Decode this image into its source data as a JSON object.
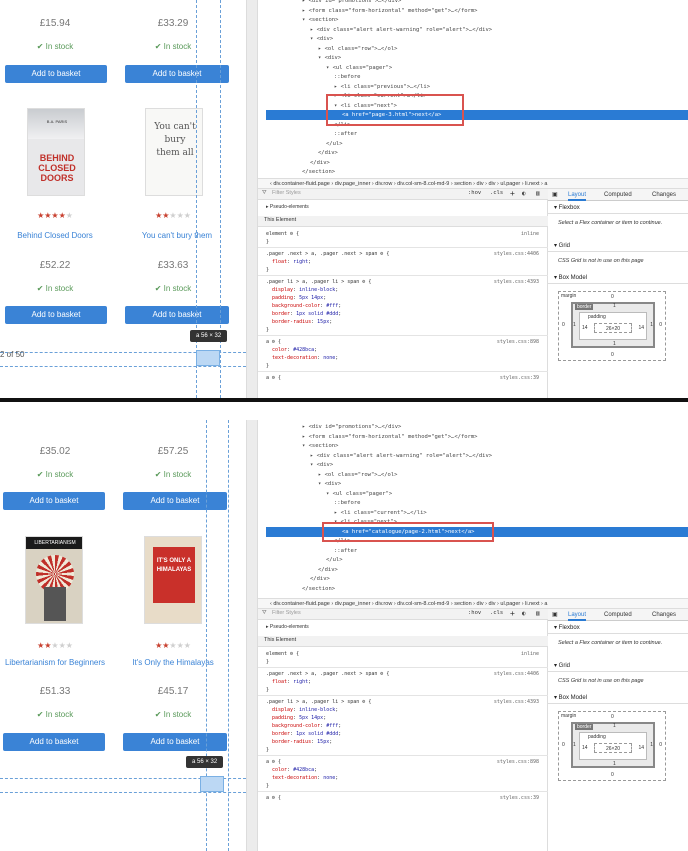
{
  "panels": [
    {
      "products_top": {
        "left": {
          "price": "£15.94",
          "stock": "In stock",
          "button": "Add to basket"
        },
        "right": {
          "price": "£33.29",
          "stock": "In stock",
          "button": "Add to basket"
        }
      },
      "products": [
        {
          "cover_text": "BEHIND CLOSED DOORS",
          "cover_author": "B.A. PARIS",
          "title": "Behind Closed Doors",
          "rating": 4,
          "price": "£52.22",
          "stock": "In stock",
          "button": "Add to basket"
        },
        {
          "cover_text": "You can't bury them all",
          "title": "You can't bury them",
          "rating": 2,
          "price": "£33.63",
          "stock": "In stock",
          "button": "Add to basket"
        }
      ],
      "page_info": "2 of 50",
      "tooltip": "a  56 × 32",
      "dom_lines": [
        "▸ <div id=\"promotions\">…</div>",
        "▸ <form class=\"form-horizontal\" method=\"get\">…</form>",
        "▾ <section>",
        "▸ <div class=\"alert alert-warning\" role=\"alert\">…</div>",
        "▾ <div>",
        "▸ <ol class=\"row\">…</ol>",
        "▾ <div>",
        "▾ <ul class=\"pager\">",
        "::before",
        "▸ <li class=\"previous\">…</li>",
        "▸ <li class=\"current\">…</li>",
        "▾ <li class=\"next\">",
        "<a href=\"page-3.html\">next</a>",
        "</li>",
        "::after",
        "</ul>",
        "</div>",
        "</div>",
        "</section>"
      ],
      "dom_selected_index": 12
    },
    {
      "products_top": {
        "left": {
          "price": "£35.02",
          "stock": "In stock",
          "button": "Add to basket"
        },
        "right": {
          "price": "£57.25",
          "stock": "In stock",
          "button": "Add to basket"
        }
      },
      "products": [
        {
          "cover_text": "LIBERTARIANISM",
          "title": "Libertarianism for Beginners",
          "rating": 2,
          "price": "£51.33",
          "stock": "In stock",
          "button": "Add to basket"
        },
        {
          "cover_text": "IT'S ONLY A HIMALAYAS",
          "title": "It's Only the Himalayas",
          "rating": 2,
          "price": "£45.17",
          "stock": "In stock",
          "button": "Add to basket"
        }
      ],
      "tooltip": "a  56 × 32",
      "dom_lines": [
        "▸ <div id=\"promotions\">…</div>",
        "▸ <form class=\"form-horizontal\" method=\"get\">…</form>",
        "▾ <section>",
        "▸ <div class=\"alert alert-warning\" role=\"alert\">…</div>",
        "▾ <div>",
        "▸ <ol class=\"row\">…</ol>",
        "▾ <div>",
        "▾ <ul class=\"pager\">",
        "::before",
        "▸ <li class=\"current\">…</li>",
        "▾ <li class=\"next\">",
        "<a href=\"catalogue/page-2.html\">next</a>",
        "</li>",
        "::after",
        "</ul>",
        "</div>",
        "</div>",
        "</section>"
      ],
      "dom_selected_index": 11
    }
  ],
  "devtools": {
    "breadcrumb": "div.container-fluid.page  ›  div.page_inner  ›  div.row  ›  div.col-sm-8.col-md-9  ›  section  ›  div  ›  div  ›  ul.pager  ›  li.next  ›  a",
    "filter_placeholder": "Filter Styles",
    "hov": ":hov",
    "cls": ".cls",
    "pseudo": "Pseudo-elements",
    "this_element": "This Element",
    "rules": [
      {
        "selector": "element",
        "source": "inline",
        "props": []
      },
      {
        "selector": ".pager .next > a, .pager .next > span",
        "source": "styles.css:4406",
        "props": [
          [
            "float",
            "right"
          ]
        ]
      },
      {
        "selector": ".pager li > a, .pager li > span",
        "source": "styles.css:4393",
        "props": [
          [
            "display",
            "inline-block"
          ],
          [
            "padding",
            "5px 14px"
          ],
          [
            "background-color",
            "#fff"
          ],
          [
            "border",
            "1px solid #ddd"
          ],
          [
            "border-radius",
            "15px"
          ]
        ]
      },
      {
        "selector": "a",
        "source": "styles.css:898",
        "props": [
          [
            "color",
            "#428bca"
          ],
          [
            "text-decoration",
            "none"
          ]
        ]
      },
      {
        "selector": "a",
        "source": "styles.css:39",
        "props": []
      }
    ],
    "tabs": [
      "Layout",
      "Computed",
      "Changes"
    ],
    "flexbox": "Flexbox",
    "flex_note": "Select a Flex container or item to continue.",
    "grid": "Grid",
    "grid_note": "CSS Grid is not in use on this page",
    "box_model": "Box Model",
    "bm": {
      "margin": "margin",
      "border": "border",
      "padding": "padding",
      "content": "26×20",
      "pad_lr": "14",
      "zero": "0",
      "one": "1"
    }
  },
  "colors": {
    "accent": "#3a83d6",
    "selection": "#2a7bd4",
    "highlight_box": "#d9534f",
    "star": "#c8402f"
  }
}
